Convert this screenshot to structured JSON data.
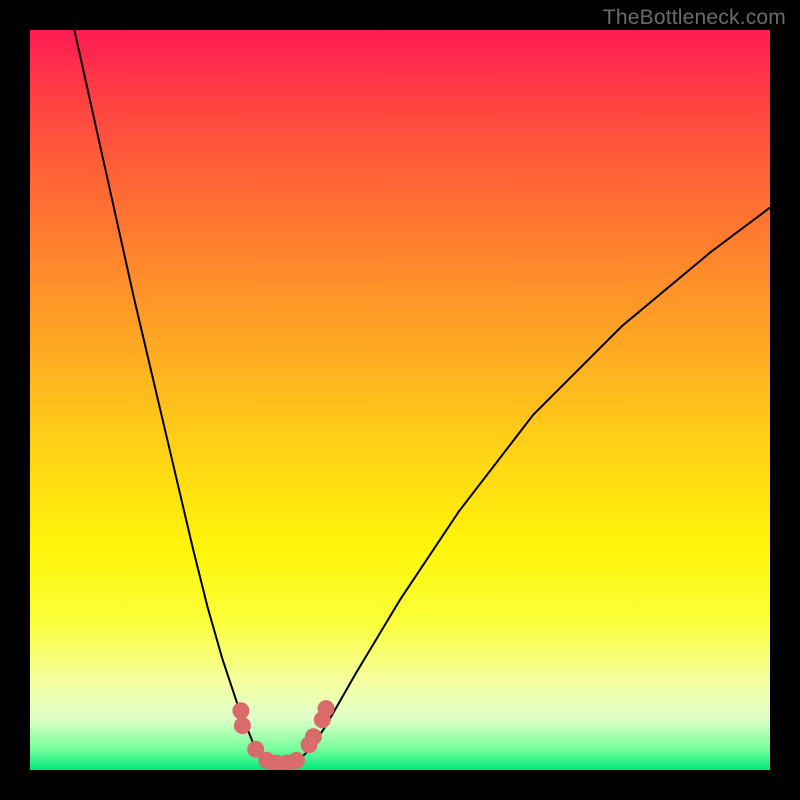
{
  "watermark": "TheBottleneck.com",
  "colors": {
    "background": "#000000",
    "curve": "#000000",
    "dot": "#d96b6b",
    "gradient_top": "#ff1b52",
    "gradient_bottom": "#00e87d"
  },
  "chart_data": {
    "type": "line",
    "title": "",
    "xlabel": "",
    "ylabel": "",
    "xlim": [
      0,
      100
    ],
    "ylim": [
      0,
      100
    ],
    "grid": false,
    "series": [
      {
        "name": "left-curve",
        "x": [
          6,
          10,
          14,
          18,
          22,
          24,
          26,
          28,
          30,
          31,
          32,
          33,
          34
        ],
        "y": [
          100,
          82,
          64,
          47,
          30,
          22,
          15,
          9,
          4,
          2,
          1,
          0.5,
          0.4
        ]
      },
      {
        "name": "right-curve",
        "x": [
          34,
          35,
          36,
          38,
          40,
          44,
          50,
          58,
          68,
          80,
          92,
          100
        ],
        "y": [
          0.4,
          0.5,
          1,
          3,
          6,
          13,
          23,
          35,
          48,
          60,
          70,
          76
        ]
      }
    ],
    "points": [
      {
        "name": "left-pair-top",
        "x": 28.5,
        "y": 8.0
      },
      {
        "name": "left-pair-bottom",
        "x": 28.7,
        "y": 6.0
      },
      {
        "name": "left-inner",
        "x": 30.5,
        "y": 2.8
      },
      {
        "name": "trough-1",
        "x": 32.0,
        "y": 1.3
      },
      {
        "name": "trough-2",
        "x": 33.3,
        "y": 0.9
      },
      {
        "name": "trough-3",
        "x": 34.7,
        "y": 0.9
      },
      {
        "name": "trough-4",
        "x": 36.0,
        "y": 1.3
      },
      {
        "name": "right-inner-a",
        "x": 37.7,
        "y": 3.4
      },
      {
        "name": "right-inner-b",
        "x": 38.3,
        "y": 4.5
      },
      {
        "name": "right-pair-top",
        "x": 40.0,
        "y": 8.3
      },
      {
        "name": "right-pair-bottom",
        "x": 39.5,
        "y": 6.8
      }
    ]
  }
}
